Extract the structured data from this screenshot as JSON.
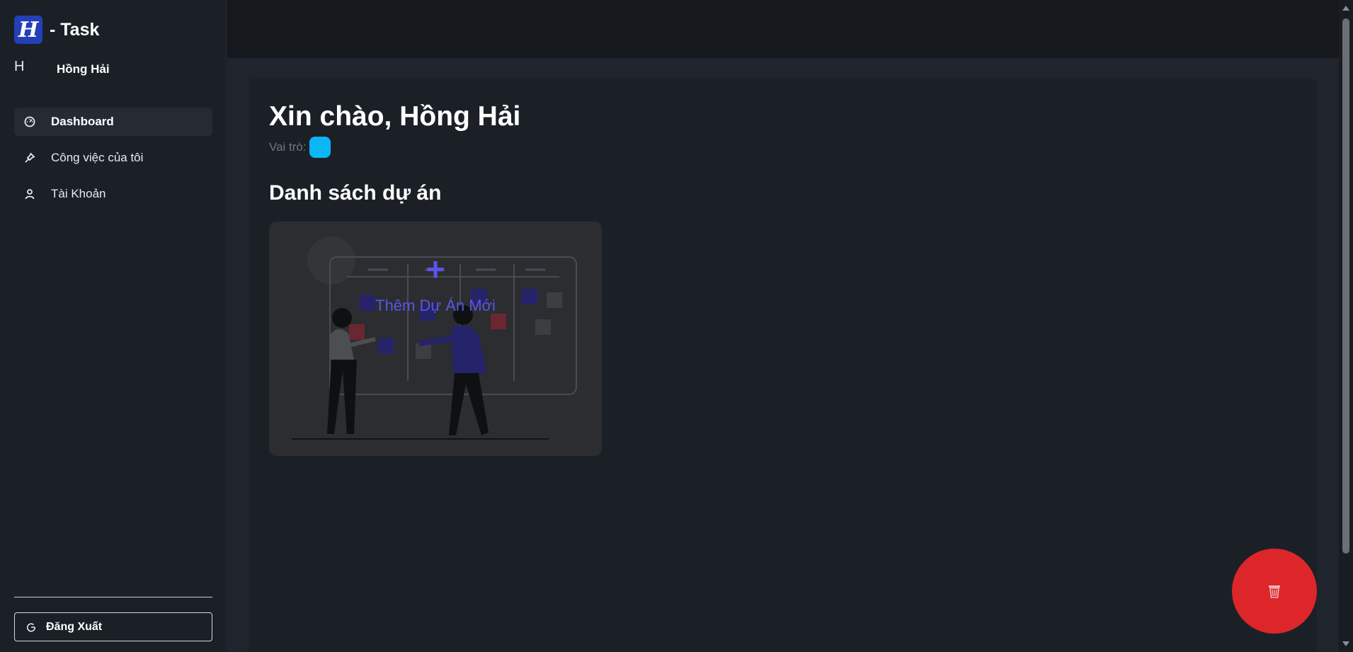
{
  "app": {
    "logo_letter": "H",
    "title": "- Task"
  },
  "user": {
    "avatar_initial": "H",
    "name": "Hồng Hải"
  },
  "sidebar": {
    "items": [
      {
        "label": "Dashboard",
        "icon": "dashboard-icon",
        "active": true
      },
      {
        "label": "Công việc của tôi",
        "icon": "pin-icon",
        "active": false
      },
      {
        "label": "Tài Khoản",
        "icon": "user-icon",
        "active": false
      }
    ],
    "logout_label": "Đăng Xuất"
  },
  "main": {
    "greeting": "Xin chào, Hồng Hải",
    "role_label": "Vai trò:",
    "role_badge_color": "#0bb6f5",
    "section_title": "Danh sách dự án",
    "add_project": {
      "plus": "+",
      "label": "Thêm Dự Án Mới"
    }
  },
  "fab": {
    "icon": "trash-icon",
    "color": "#dc262a"
  },
  "colors": {
    "accent": "#5a55e6",
    "logo_bg": "#2340b8",
    "danger": "#dc262a"
  }
}
